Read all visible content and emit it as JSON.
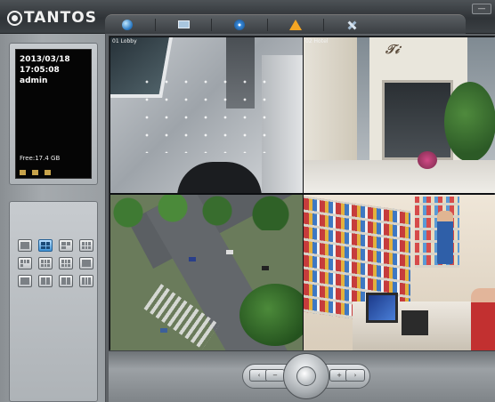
{
  "app": {
    "brand": "TANTOS",
    "window_button": "—"
  },
  "toolbar": {
    "buttons": [
      {
        "icon": "globe-icon"
      },
      {
        "icon": "monitor-icon"
      },
      {
        "icon": "disc-icon"
      },
      {
        "icon": "warning-icon"
      },
      {
        "icon": "tools-icon"
      }
    ]
  },
  "status_panel": {
    "date": "2013/03/18",
    "time": "17:05:08",
    "user": "admin",
    "free_space": "Free:17.4 GB"
  },
  "layout_buttons": {
    "active_index": 1,
    "count": 12
  },
  "cameras": [
    {
      "label": "01 Lobby",
      "view": "hallway"
    },
    {
      "label": "02 Hotel",
      "view": "storefront"
    },
    {
      "label": "",
      "view": "intersection"
    },
    {
      "label": "",
      "view": "store"
    }
  ],
  "colors": {
    "accent": "#3e92d6",
    "background": "#5e6266",
    "warning": "#f5a623"
  }
}
